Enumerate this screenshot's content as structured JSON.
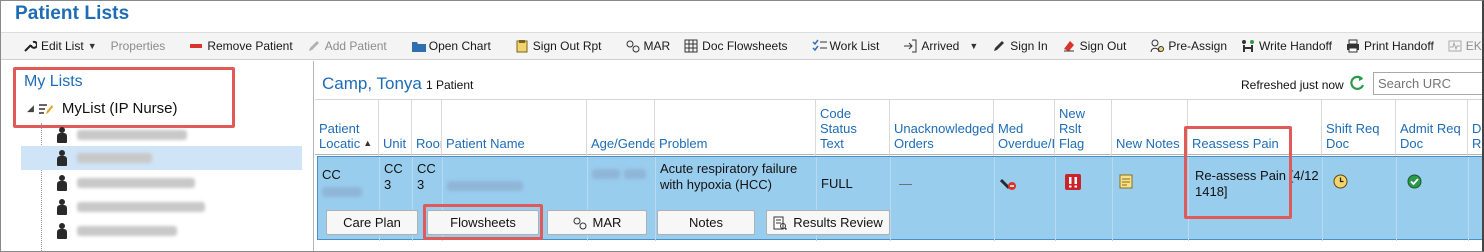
{
  "app": {
    "title": "Patient Lists"
  },
  "toolbar": {
    "edit_list": "Edit List",
    "properties": "Properties",
    "remove_patient": "Remove Patient",
    "add_patient": "Add Patient",
    "open_chart": "Open Chart",
    "sign_out_rpt": "Sign Out Rpt",
    "mar": "MAR",
    "doc_flowsheets": "Doc Flowsheets",
    "work_list": "Work List",
    "arrived": "Arrived",
    "sign_in": "Sign In",
    "sign_out": "Sign Out",
    "pre_assign": "Pre-Assign",
    "write_handoff": "Write Handoff",
    "print_handoff": "Print Handoff",
    "ekg": "EKG Dia"
  },
  "sidebar": {
    "heading": "My Lists",
    "list_name": "MyList (IP Nurse)"
  },
  "group": {
    "name": "Camp, Tonya",
    "count": "1 Patient",
    "refreshed": "Refreshed just now",
    "search_placeholder": "Search URC"
  },
  "columns": {
    "location": "Patient\nLocatic",
    "unit": "Unit",
    "room": "Roor",
    "patient_name": "Patient Name",
    "age_gender": "Age/Gende",
    "problem": "Problem",
    "code_status": "Code\nStatus\nText",
    "unack_orders": "Unacknowledged\nOrders",
    "med_overdue": "Med\nOverdue/I",
    "new_rslt": "New\nRslt\nFlag",
    "new_notes": "New Notes",
    "reassess_pain": "Reassess Pain",
    "shift_req": "Shift Req\nDoc",
    "admit_req": "Admit Req\nDoc",
    "do": "Do\nR"
  },
  "row": {
    "location": "CC",
    "unit": "CC\n3",
    "room": "CC\n3",
    "problem": "Acute respiratory failure with hypoxia (HCC)",
    "code_status": "FULL",
    "unack_orders": "—",
    "reassess_pain": "Re-assess Pain [4/12 1418]"
  },
  "actions": {
    "care_plan": "Care Plan",
    "flowsheets": "Flowsheets",
    "mar": "MAR",
    "notes": "Notes",
    "results_review": "Results Review"
  },
  "colors": {
    "accent": "#1e6cb5",
    "selected_row": "#99cdee",
    "highlight_box": "#e05a5a"
  }
}
